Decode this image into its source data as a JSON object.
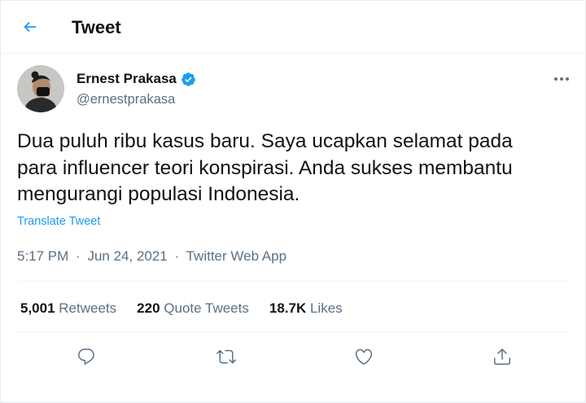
{
  "header": {
    "title": "Tweet",
    "back_icon": "arrow-left-icon"
  },
  "author": {
    "name": "Ernest Prakasa",
    "handle": "@ernestprakasa",
    "verified": true
  },
  "tweet": {
    "text": "Dua puluh ribu kasus baru. Saya ucapkan selamat pada\npara influencer teori konspirasi. Anda sukses membantu\nmengurangi populasi Indonesia.",
    "translate_label": "Translate Tweet",
    "time": "5:17 PM",
    "date": "Jun 24, 2021",
    "source": "Twitter Web App",
    "separator": "·"
  },
  "stats": {
    "retweets_count": "5,001",
    "retweets_label": "Retweets",
    "quotes_count": "220",
    "quotes_label": "Quote Tweets",
    "likes_count": "18.7K",
    "likes_label": "Likes"
  },
  "actions": [
    "reply-icon",
    "retweet-icon",
    "like-icon",
    "share-icon"
  ],
  "colors": {
    "accent": "#1d9bf0",
    "text": "#0f1419",
    "secondary": "#5b7083",
    "border": "#eff3f4"
  }
}
